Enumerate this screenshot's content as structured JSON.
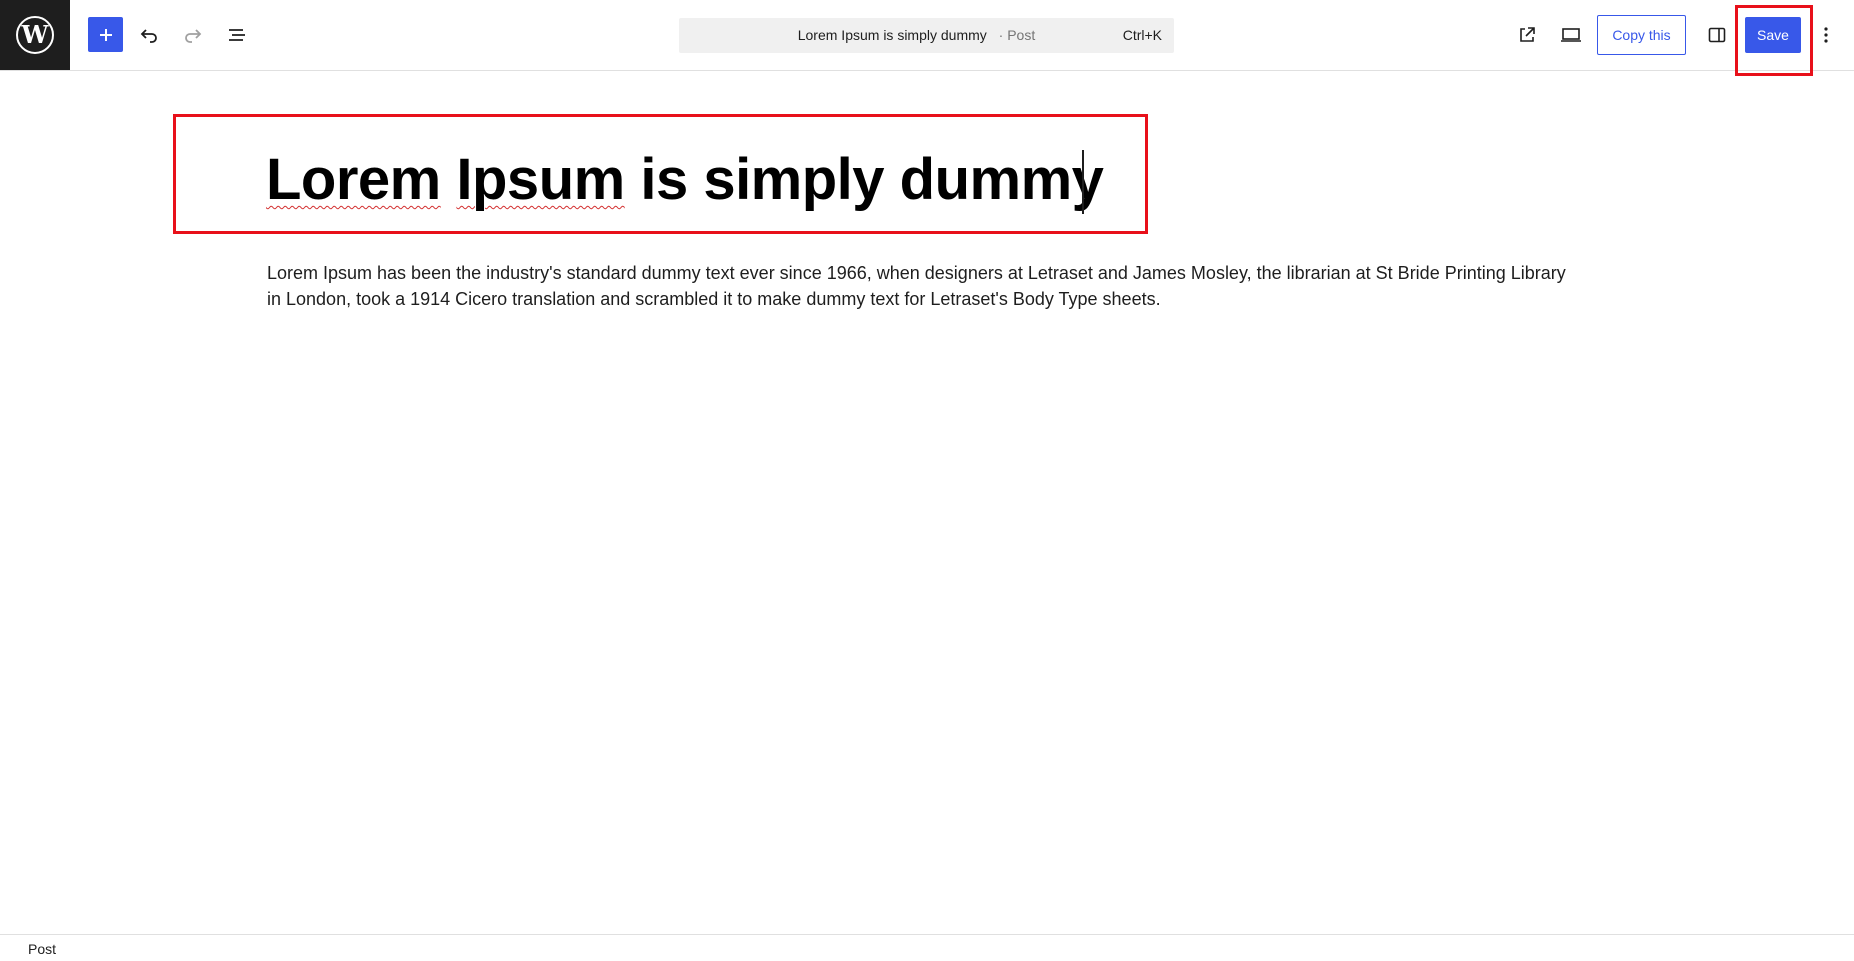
{
  "app": {
    "logo": "wordpress-logo"
  },
  "toolbar": {
    "add_icon": "plus-icon",
    "undo_icon": "undo-icon",
    "redo_icon": "redo-icon",
    "document_overview_icon": "list-view-icon",
    "view_post_icon": "external-link-icon",
    "preview_icon": "desktop-icon",
    "copy_label": "Copy this",
    "settings_icon": "sidebar-toggle-icon",
    "save_label": "Save",
    "options_icon": "more-vertical-icon"
  },
  "command_bar": {
    "post_title": "Lorem Ipsum is simply dummy",
    "post_type": "· Post",
    "shortcut": "Ctrl+K"
  },
  "editor": {
    "title_part1": "Lorem",
    "title_part2": "Ipsum",
    "title_part3": "is simply dummy",
    "paragraph": " Lorem Ipsum has been the industry's standard dummy text ever since 1966, when designers at Letraset and James Mosley, the librarian at St Bride Printing Library in London, took a 1914 Cicero translation and scrambled it to make dummy text for Letraset's Body Type sheets."
  },
  "statusbar": {
    "breadcrumb": "Post"
  },
  "colors": {
    "accent": "#3858e9",
    "highlight": "#e8101a",
    "logo_bg": "#1e1e1e"
  }
}
